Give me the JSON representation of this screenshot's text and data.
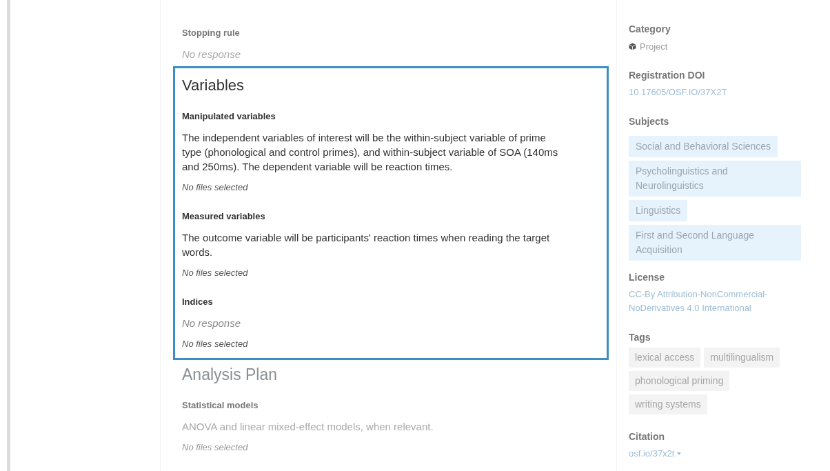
{
  "sections": [
    {
      "highlighted": false,
      "questions": [
        {
          "label": "Stopping rule",
          "answer": "No response",
          "answered": false
        }
      ]
    },
    {
      "title": "Variables",
      "highlighted": true,
      "questions": [
        {
          "label": "Manipulated variables",
          "answer": "The independent variables of interest will be the within-subject variable of prime type (phonological and control primes), and within-subject variable of SOA (140ms and 250ms). The dependent variable will be reaction times.",
          "answered": true,
          "files": "No files selected"
        },
        {
          "label": "Measured variables",
          "answer": "The outcome variable will be participants' reaction times when reading the target words.",
          "answered": true,
          "files": "No files selected"
        },
        {
          "label": "Indices",
          "answer": "No response",
          "answered": false,
          "files": "No files selected"
        }
      ]
    },
    {
      "title": "Analysis Plan",
      "highlighted": false,
      "questions": [
        {
          "label": "Statistical models",
          "answer": "ANOVA and linear mixed-effect models, when relevant.",
          "answered": true,
          "files": "No files selected"
        }
      ]
    }
  ],
  "sidebar": [
    {
      "heading": "Category",
      "kind": "category",
      "text": "Project"
    },
    {
      "heading": "Registration DOI",
      "kind": "link",
      "text": "10.17605/OSF.IO/37X2T"
    },
    {
      "heading": "Subjects",
      "kind": "subjects",
      "items": [
        "Social and Behavioral Sciences",
        "Psycholinguistics and Neurolinguistics",
        "Linguistics",
        "First and Second Language Acquisition"
      ]
    },
    {
      "heading": "License",
      "kind": "link",
      "text": "CC-By Attribution-NonCommercial-NoDerivatives 4.0 International"
    },
    {
      "heading": "Tags",
      "kind": "tags",
      "items": [
        "lexical access",
        "multilingualism",
        "phonological priming",
        "writing systems"
      ]
    },
    {
      "heading": "Citation",
      "kind": "dropdown",
      "text": "osf.io/37x2t"
    }
  ]
}
